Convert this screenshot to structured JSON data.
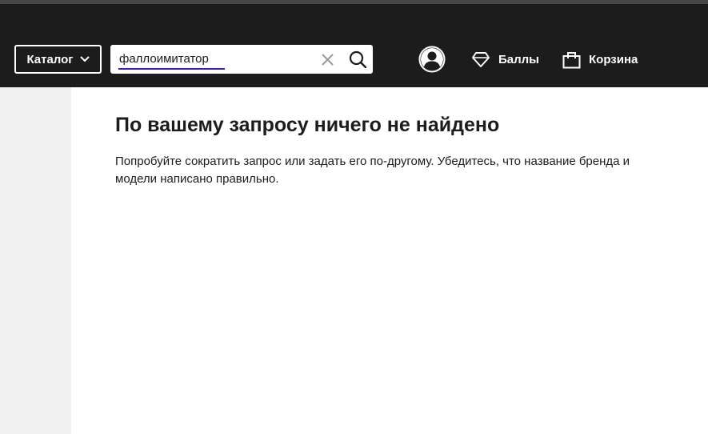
{
  "header": {
    "catalog_label": "Каталог",
    "search": {
      "value": "фаллоимитатор"
    },
    "bonus_label": "Баллы",
    "cart_label": "Корзина"
  },
  "icons": {
    "catalog": "chevron-down-icon",
    "clear": "close-icon",
    "search": "search-icon",
    "profile": "user-avatar-icon",
    "bonus": "diamond-icon",
    "cart": "shopping-bag-icon"
  },
  "colors": {
    "header_bg": "#1c1c1c",
    "search_underline": "#2f1bd6",
    "page_bg": "#f0f0f0"
  },
  "main": {
    "title": "По вашему запросу ничего не найдено",
    "message": "Попробуйте сократить запрос или задать его по-другому. Убедитесь, что название бренда и модели написано правильно."
  }
}
